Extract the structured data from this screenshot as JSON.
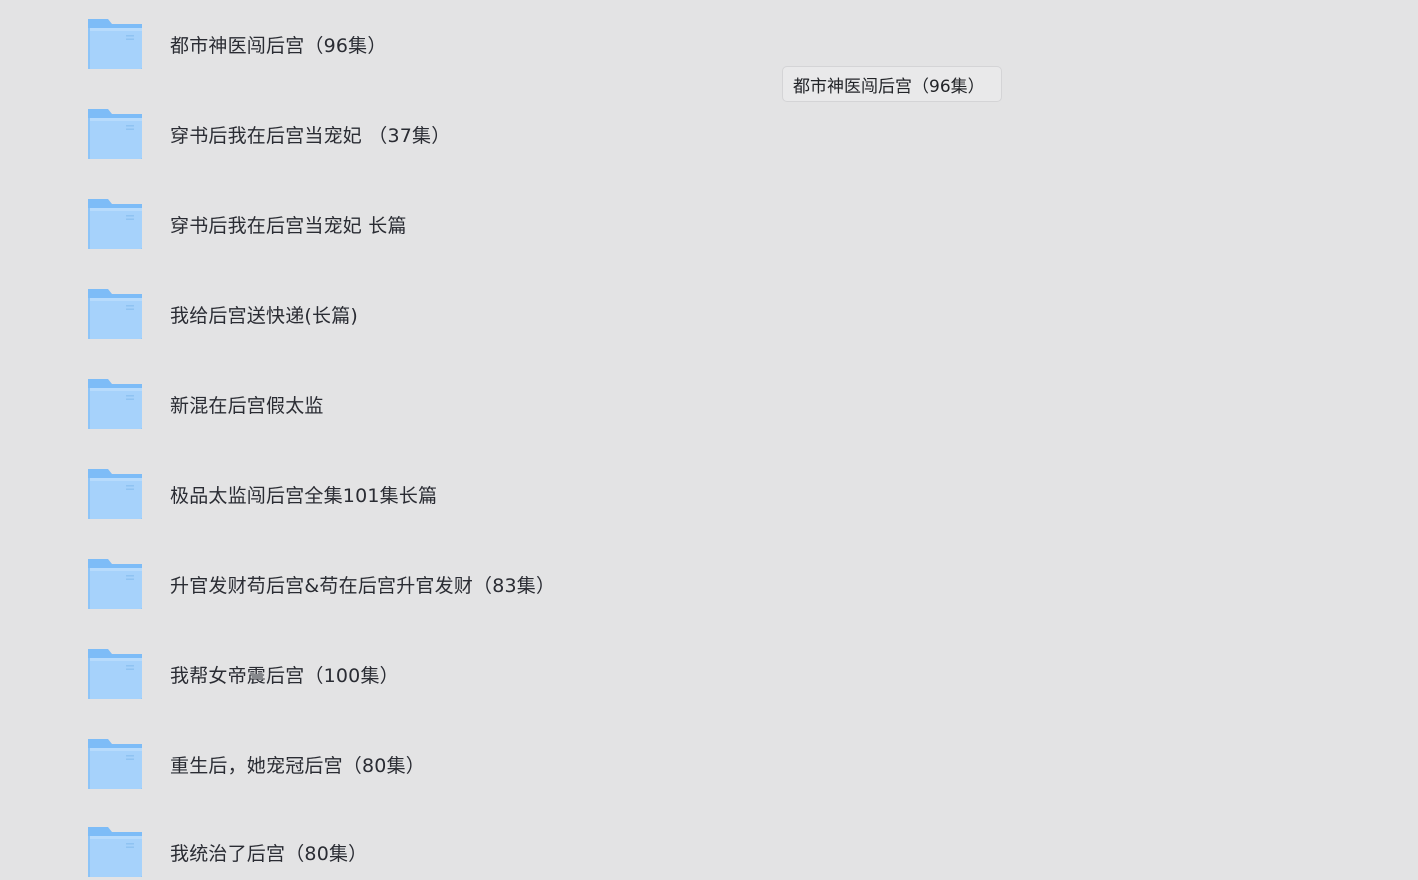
{
  "folders": [
    {
      "name": "都市神医闯后宫（96集）",
      "icon": "folder-icon"
    },
    {
      "name": "穿书后我在后宫当宠妃 （37集）",
      "icon": "folder-icon"
    },
    {
      "name": "穿书后我在后宫当宠妃 长篇",
      "icon": "folder-icon"
    },
    {
      "name": "我给后宫送快递(长篇)",
      "icon": "folder-icon"
    },
    {
      "name": "新混在后宫假太监",
      "icon": "folder-icon"
    },
    {
      "name": "极品太监闯后宫全集101集长篇",
      "icon": "folder-icon"
    },
    {
      "name": "升官发财苟后宫&苟在后宫升官发财（83集）",
      "icon": "folder-icon"
    },
    {
      "name": "我帮女帝震后宫（100集）",
      "icon": "folder-icon"
    },
    {
      "name": "重生后，她宠冠后宫（80集）",
      "icon": "folder-icon"
    },
    {
      "name": "我统治了后宫（80集）",
      "icon": "folder-icon"
    }
  ],
  "tooltip": {
    "text": "都市神医闯后宫（96集）"
  },
  "colors": {
    "background": "#e3e3e4",
    "folder_back": "#7dbcf7",
    "folder_front": "#a6d2fb",
    "text": "#2a2c33"
  }
}
